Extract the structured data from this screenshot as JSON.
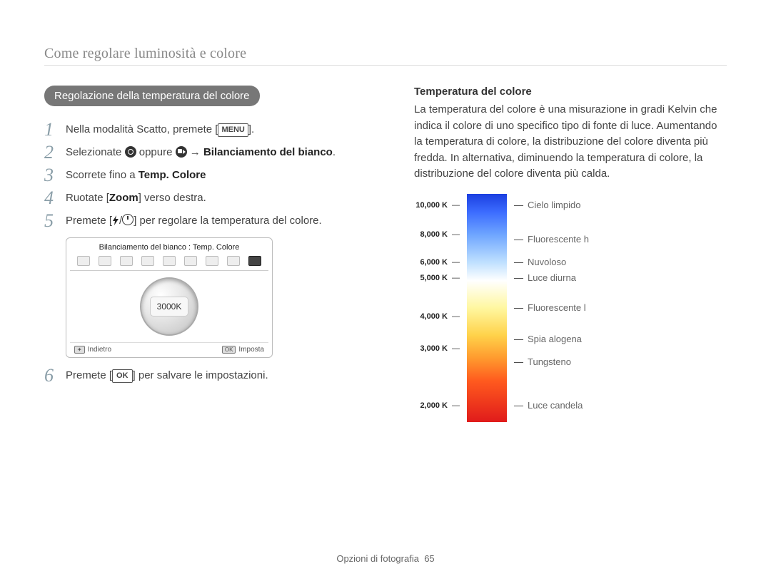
{
  "breadcrumb": "Come regolare luminosità e colore",
  "pill": "Regolazione della temperatura del colore",
  "steps": {
    "s1a": "Nella modalità Scatto, premete [",
    "s1_menu": "MENU",
    "s1b": "].",
    "s2a": "Selezionate ",
    "s2b": " oppure ",
    "s2c": " → ",
    "s2d": "Bilanciamento del bianco",
    "s2e": ".",
    "s3a": "Scorrete fino a ",
    "s3b": "Temp. Colore",
    "s4a": "Ruotate [",
    "s4b": "Zoom",
    "s4c": "] verso destra.",
    "s5a": "Premete [",
    "s5b": "/",
    "s5c": "] per regolare la temperatura del colore.",
    "s6a": "Premete [",
    "s6_ok": "OK",
    "s6b": "] per salvare le impostazioni."
  },
  "screenshot": {
    "title": "Bilanciamento del bianco : Temp. Colore",
    "dial_value": "3000K",
    "back_btn": "✦",
    "back_label": "Indietro",
    "ok_btn": "OK",
    "ok_label": "Imposta"
  },
  "right": {
    "heading": "Temperatura del colore",
    "paragraph": "La temperatura del colore è una misurazione in gradi Kelvin che indica il colore di uno specifico tipo di fonte di luce. Aumentando la temperatura di colore, la distribuzione del colore diventa più fredda. In alternativa, diminuendo la temperatura di colore, la distribuzione del colore diventa più calda."
  },
  "kelvin_ticks": [
    {
      "label": "10,000 K",
      "pct": 5
    },
    {
      "label": "8,000 K",
      "pct": 18
    },
    {
      "label": "6,000 K",
      "pct": 30
    },
    {
      "label": "5,000 K",
      "pct": 37
    },
    {
      "label": "4,000 K",
      "pct": 54
    },
    {
      "label": "3,000 K",
      "pct": 68
    },
    {
      "label": "2,000 K",
      "pct": 93
    }
  ],
  "kelvin_labels": [
    {
      "label": "Cielo limpido",
      "pct": 5
    },
    {
      "label": "Fluorescente h",
      "pct": 20
    },
    {
      "label": "Nuvoloso",
      "pct": 30
    },
    {
      "label": "Luce diurna",
      "pct": 37
    },
    {
      "label": "Fluorescente l",
      "pct": 50
    },
    {
      "label": "Spia alogena",
      "pct": 64
    },
    {
      "label": "Tungsteno",
      "pct": 74
    },
    {
      "label": "Luce candela",
      "pct": 93
    }
  ],
  "footer": {
    "section": "Opzioni di fotografia",
    "page": "65"
  }
}
